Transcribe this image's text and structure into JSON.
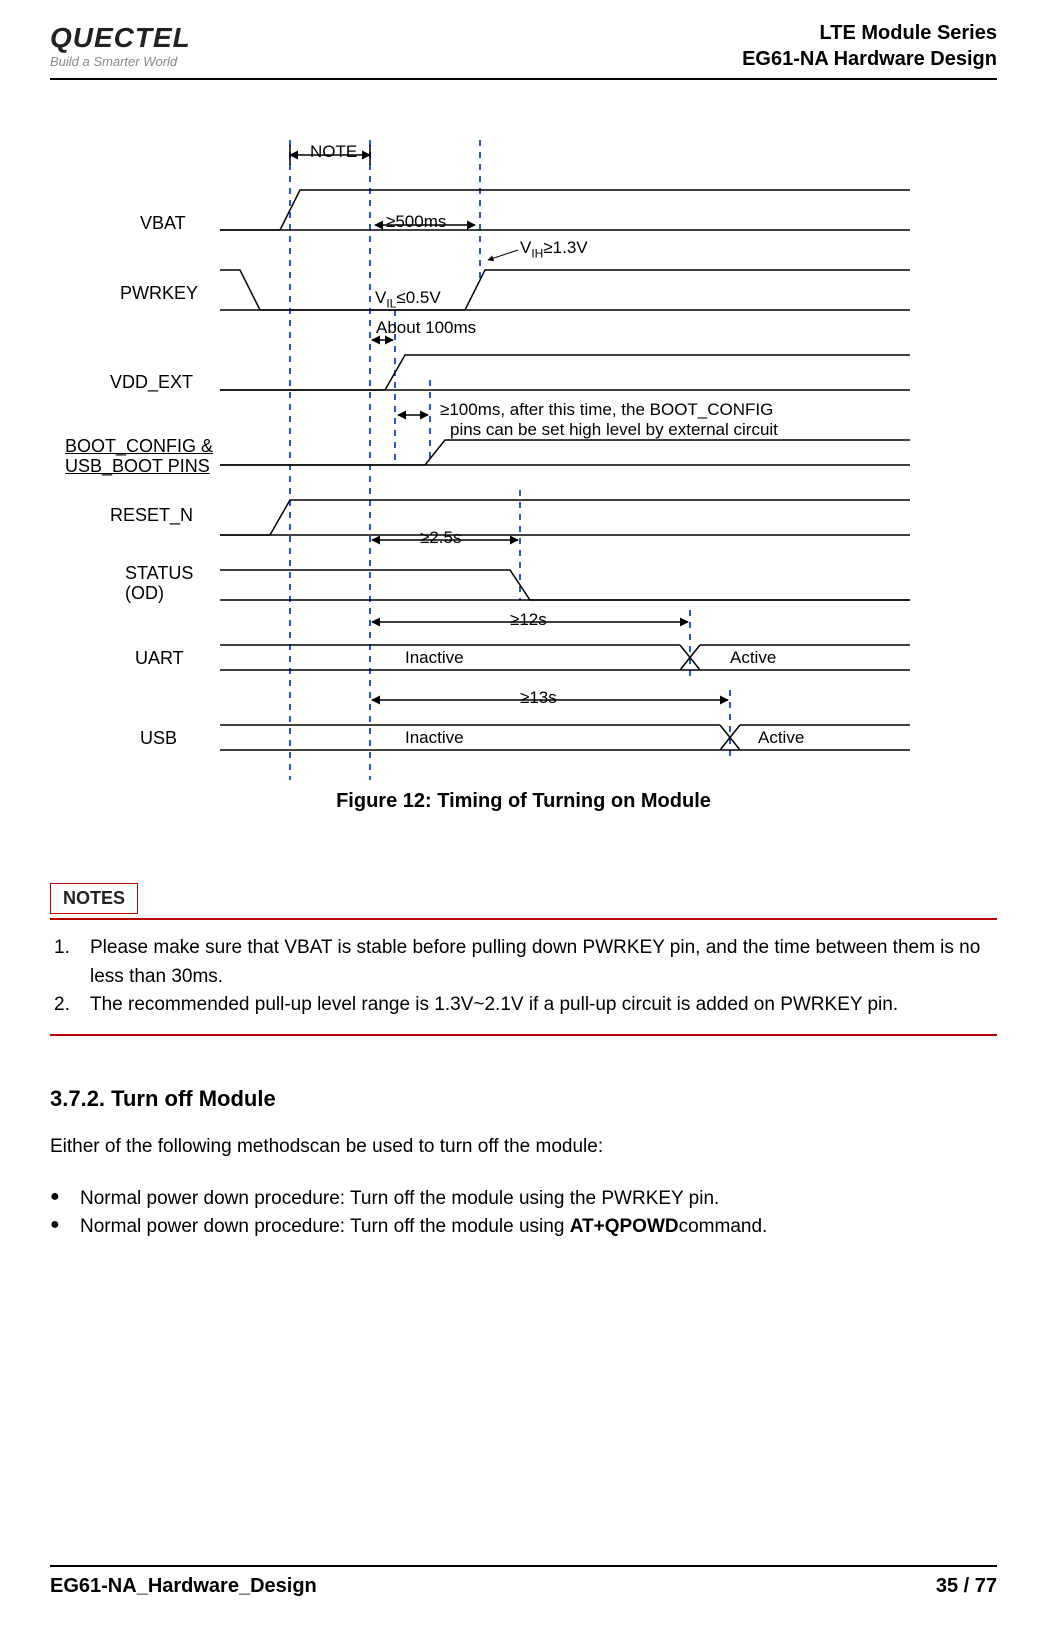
{
  "header": {
    "logo_main": "QUECTEL",
    "logo_sub": "Build a Smarter World",
    "line1": "LTE Module Series",
    "line2": "EG61-NA Hardware Design"
  },
  "diagram": {
    "note": "NOTE",
    "labels": {
      "vbat": "VBAT",
      "pwrkey": "PWRKEY",
      "vdd_ext": "VDD_EXT",
      "boot": "BOOT_CONFIG &",
      "boot2": "USB_BOOT PINS",
      "reset": "RESET_N",
      "status": "STATUS",
      "status2": "(OD)",
      "uart": "UART",
      "usb": "USB"
    },
    "texts": {
      "ge500": "≥500ms",
      "vih": "V",
      "vih_sub": "IH",
      "vih_tail": "≥1.3V",
      "vil": "V",
      "vil_sub": "IL",
      "vil_tail": "≤0.5V",
      "about100": "About 100ms",
      "ge100msg1": "≥100ms, after this time, the BOOT_CONFIG",
      "ge100msg2": "pins can be set high level by external circuit",
      "ge25": "≥2.5s",
      "ge12": "≥12s",
      "ge13": "≥13s",
      "inactive": "Inactive",
      "active": "Active"
    }
  },
  "figure_caption": "Figure 12: Timing of Turning on Module",
  "notes_label": "NOTES",
  "notes": [
    "Please make sure that VBAT is stable before pulling down PWRKEY pin, and the time between them is no less than 30ms.",
    "The recommended pull-up level range is 1.3V~2.1V if a pull-up circuit is added on PWRKEY pin."
  ],
  "section_head": "3.7.2.  Turn off Module",
  "section_p": "Either of the following methodscan be used to turn off the module:",
  "bullets": [
    {
      "pre": "Normal power down procedure: Turn off the module using the PWRKEY pin.",
      "bold": ""
    },
    {
      "pre": "Normal power down procedure: Turn off the module using ",
      "bold": "AT+QPOWD",
      "post": "command."
    }
  ],
  "footer": {
    "left": "EG61-NA_Hardware_Design",
    "right": "35 / 77"
  },
  "chart_data": {
    "type": "timing-diagram",
    "signals": [
      {
        "name": "VBAT",
        "event": "rises at t0, stable before PWRKEY pulldown",
        "note_span": "NOTE marks VBAT-stable-to-PWRKEY interval (≥30ms per notes)"
      },
      {
        "name": "PWRKEY",
        "event": "pulled low (VIL≤0.5V) for ≥500ms then released to high (VIH≥1.3V)"
      },
      {
        "name": "VDD_EXT",
        "event": "rises ~100ms after PWRKEY low; label 'About 100ms'"
      },
      {
        "name": "BOOT_CONFIG & USB_BOOT PINS",
        "event": "can be set high by external circuit ≥100ms after VDD_EXT rises"
      },
      {
        "name": "RESET_N",
        "event": "goes high after PWRKEY low"
      },
      {
        "name": "STATUS (OD)",
        "event": "asserts ≥2.5s after PWRKEY low"
      },
      {
        "name": "UART",
        "event": "Inactive → Active, transition ≥12s after PWRKEY low"
      },
      {
        "name": "USB",
        "event": "Inactive → Active, transition ≥13s after PWRKEY low"
      }
    ],
    "timings": [
      {
        "label": "≥500ms",
        "from": "PWRKEY falling edge",
        "to": "PWRKEY rising edge"
      },
      {
        "label": "About 100ms",
        "from": "PWRKEY falling edge",
        "to": "VDD_EXT rising edge"
      },
      {
        "label": "≥100ms",
        "from": "VDD_EXT rising edge",
        "to": "BOOT_CONFIG settable"
      },
      {
        "label": "≥2.5s",
        "from": "PWRKEY falling edge",
        "to": "STATUS asserted"
      },
      {
        "label": "≥12s",
        "from": "PWRKEY falling edge",
        "to": "UART Active"
      },
      {
        "label": "≥13s",
        "from": "PWRKEY falling edge",
        "to": "USB Active"
      }
    ],
    "thresholds": {
      "VIH": "≥1.3V",
      "VIL": "≤0.5V"
    }
  }
}
